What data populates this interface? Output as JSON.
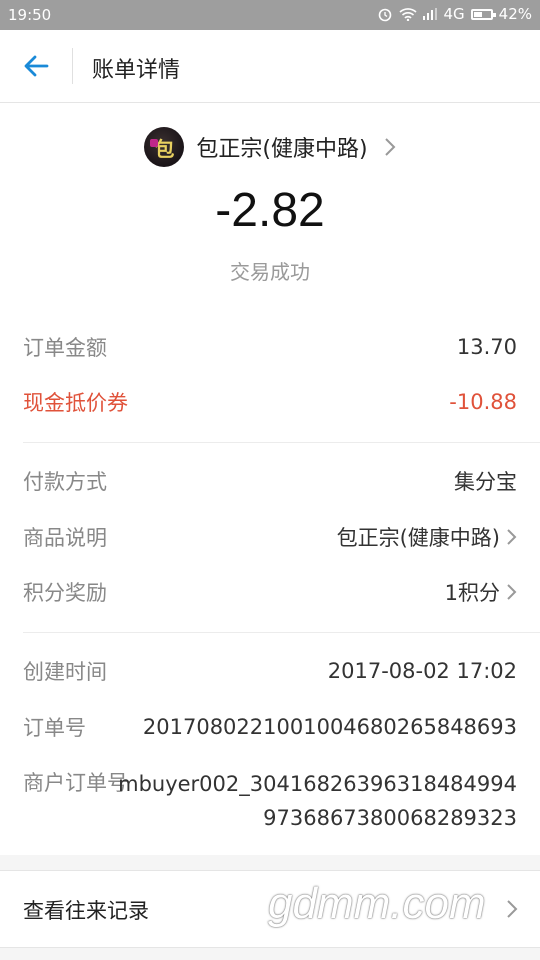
{
  "status_bar": {
    "time": "19:50",
    "network": "4G",
    "battery": "42%"
  },
  "header": {
    "title": "账单详情",
    "back_icon": "back-arrow-icon"
  },
  "merchant": {
    "name": "包正宗(健康中路)"
  },
  "amount": "-2.82",
  "status": "交易成功",
  "details": {
    "order_amount_label": "订单金额",
    "order_amount_value": "13.70",
    "coupon_label": "现金抵价券",
    "coupon_value": "-10.88",
    "payment_method_label": "付款方式",
    "payment_method_value": "集分宝",
    "product_label": "商品说明",
    "product_value": "包正宗(健康中路)",
    "points_label": "积分奖励",
    "points_value": "1积分",
    "created_label": "创建时间",
    "created_value": "2017-08-02 17:02",
    "order_no_label": "订单号",
    "order_no_value": "2017080221001004680265848693",
    "merchant_order_label": "商户订单号",
    "merchant_order_line1": "mbuyer002_3041682639631848499​4",
    "merchant_order_line2": "9736867380068289323"
  },
  "history": {
    "label": "查看往来记录",
    "watermark": "gdmm.com"
  },
  "colors": {
    "accent": "#1a8ad8",
    "coupon": "#e0523a"
  }
}
